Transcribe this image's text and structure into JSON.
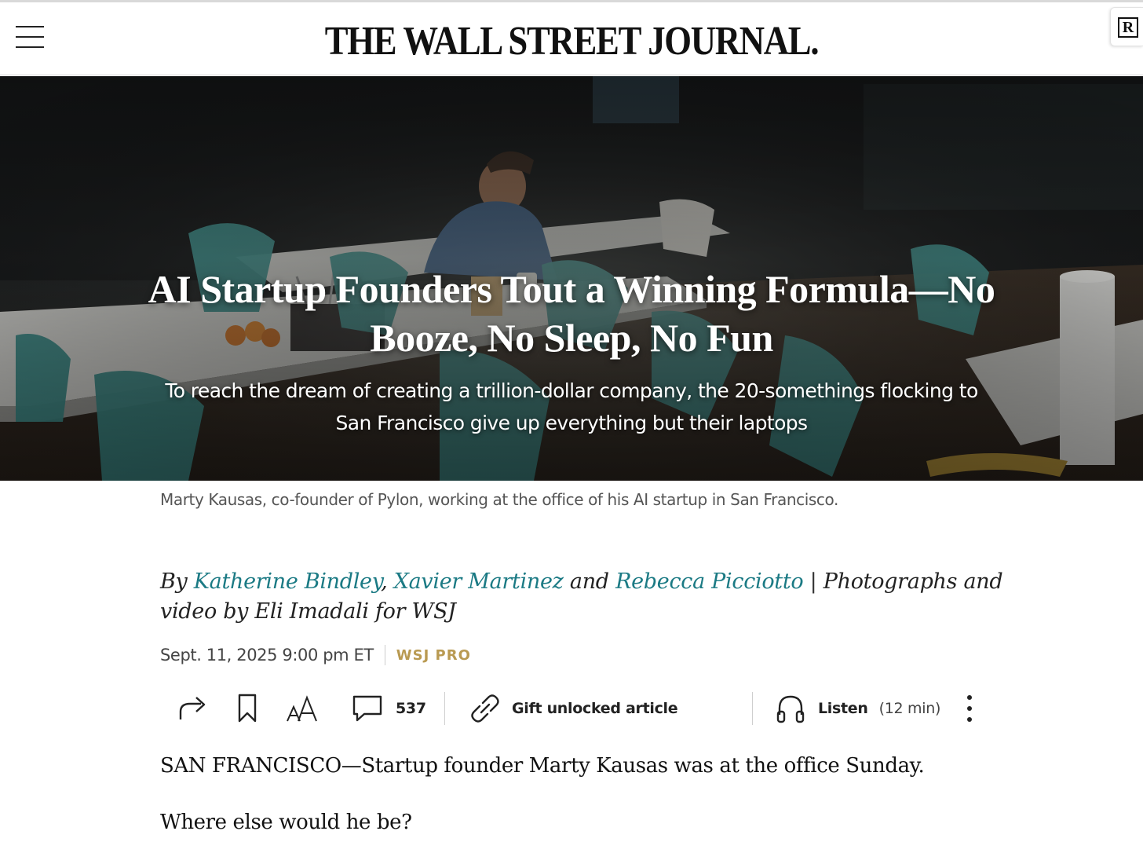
{
  "header": {
    "masthead": "THE WALL STREET JOURNAL.",
    "menu_icon": "hamburger-menu-icon",
    "extension_badge": "R"
  },
  "hero": {
    "title_line1": "AI Startup Founders Tout a Winning Formula—No",
    "title_line2": "Booze, No Sleep, No Fun",
    "dek_line1": "To reach the dream of creating a trillion-dollar company, the 20-somethings flocking to",
    "dek_line2": "San Francisco give up everything but their laptops",
    "caption": "Marty Kausas, co-founder of Pylon, working at the office of his AI startup in San Francisco."
  },
  "byline": {
    "by": "By",
    "author1": "Katherine Bindley",
    "comma": ",",
    "author2": "Xavier Martinez",
    "and": "and",
    "author3": "Rebecca Picciotto",
    "separator": "|",
    "credit_line1": "Photographs and",
    "credit_line2": "video by Eli Imadali for WSJ",
    "date": "Sept. 11, 2025 9:00 pm ET",
    "section_badge": "WSJ PRO"
  },
  "toolbar": {
    "share_icon": "share-arrow-icon",
    "bookmark_icon": "bookmark-icon",
    "text_size_icon": "text-size-icon",
    "comment_icon": "comment-bubble-icon",
    "comment_count": "537",
    "gift_icon": "link-icon",
    "gift_label": "Gift unlocked article",
    "listen_icon": "headphones-icon",
    "listen_label": "Listen",
    "listen_duration": "(12 min)",
    "more_icon": "more-vertical-icon"
  },
  "body": {
    "para1": "SAN FRANCISCO—Startup founder Marty Kausas was at the office Sunday.",
    "para2": "Where else would he be?"
  },
  "colors": {
    "link": "#1b7a84",
    "wsj_pro": "#b99a52",
    "chair_teal": "#3f8f8c"
  }
}
